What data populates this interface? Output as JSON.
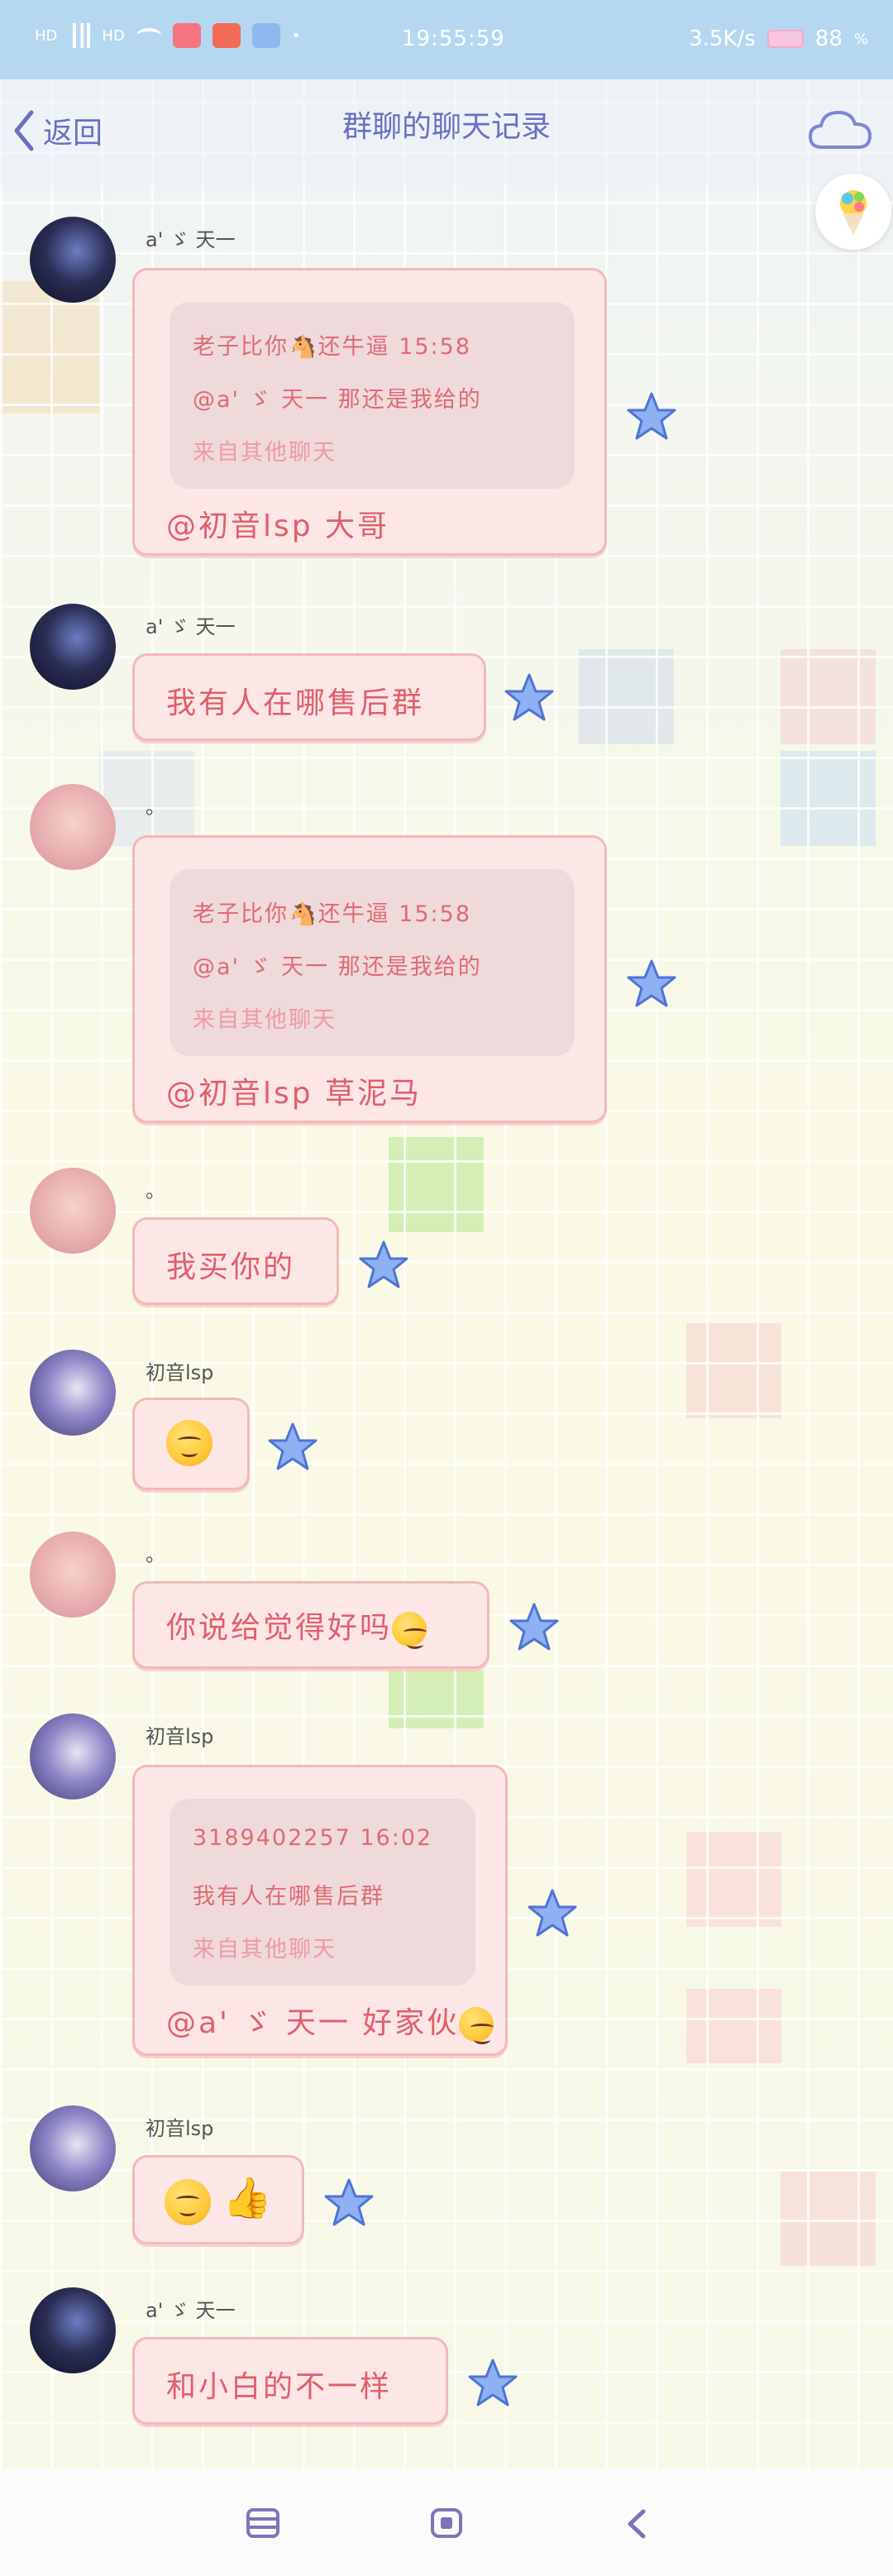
{
  "status_bar": {
    "time": "19:55:59",
    "network_speed": "3.5K/s",
    "battery": "88",
    "battery_unit": "%",
    "signal_label": "HD"
  },
  "header": {
    "back_label": "返回",
    "title": "群聊的聊天记录"
  },
  "messages": [
    {
      "sender": "a' ゞ 天一",
      "avatar": "anime-boy-avatar",
      "quote": {
        "line1": "老子比你🐴还牛逼 15:58",
        "line2": "@a' ゞ 天一  那还是我给的",
        "line3": "来自其他聊天"
      },
      "text": "@初音lsp 大哥"
    },
    {
      "sender": "a' ゞ 天一",
      "avatar": "anime-boy-avatar",
      "text": "我有人在哪售后群"
    },
    {
      "sender": "。",
      "avatar": "boy-avatar",
      "quote": {
        "line1": "老子比你🐴还牛逼 15:58",
        "line2": "@a' ゞ 天一  那还是我给的",
        "line3": "来自其他聊天"
      },
      "text": "@初音lsp 草泥马"
    },
    {
      "sender": "。",
      "avatar": "boy-avatar",
      "text": "我买你的"
    },
    {
      "sender": "初音lsp",
      "avatar": "miku-avatar",
      "text": "",
      "emoji": "smirk-face"
    },
    {
      "sender": "。",
      "avatar": "boy-avatar",
      "text": "你说给觉得好吗",
      "emoji": "laughing-face"
    },
    {
      "sender": "初音lsp",
      "avatar": "miku-avatar",
      "quote": {
        "line1": "3189402257 16:02",
        "line2": "我有人在哪售后群",
        "line3": "来自其他聊天"
      },
      "text": "@a' ゞ 天一  好家伙",
      "emoji": "smirk-face"
    },
    {
      "sender": "初音lsp",
      "avatar": "miku-avatar",
      "text": "",
      "emoji": "grin-face-thumbs-up"
    },
    {
      "sender": "a' ゞ 天一",
      "avatar": "anime-boy-avatar",
      "text": "和小白的不一样"
    }
  ],
  "colors": {
    "accent": "#6b6fc4",
    "bubble_bg": "#fde6e6",
    "bubble_border": "#f3b8bb",
    "bubble_text": "#e05f6a",
    "star": "#6e95e8",
    "status_bar": "#b6d7f0"
  }
}
